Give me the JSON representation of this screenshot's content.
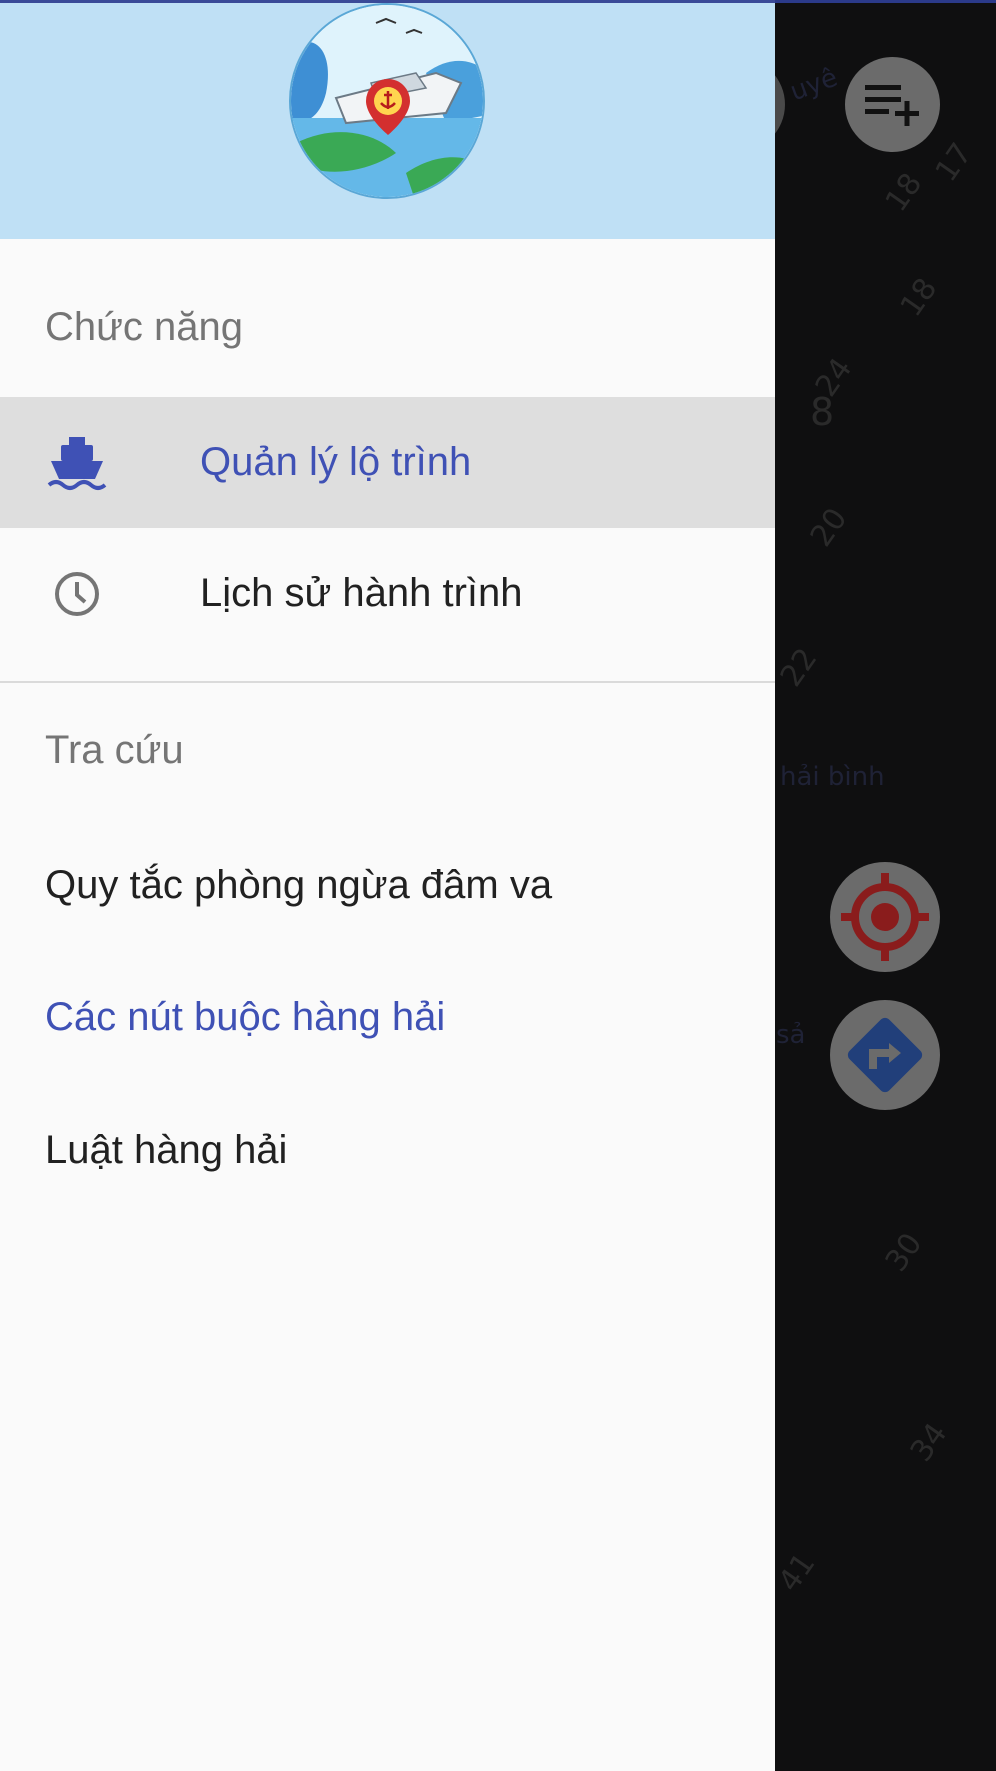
{
  "drawer": {
    "sections": [
      {
        "title": "Chức năng",
        "items": [
          {
            "label": "Quản lý lộ trình",
            "icon": "ship-icon",
            "active": true
          },
          {
            "label": "Lịch sử hành trình",
            "icon": "clock-icon",
            "active": false
          }
        ]
      },
      {
        "title": "Tra cứu",
        "items": [
          {
            "label": "Quy tắc phòng ngừa đâm va"
          },
          {
            "label": "Các nút buộc hàng hải"
          },
          {
            "label": "Luật hàng hải"
          }
        ]
      }
    ]
  },
  "map": {
    "depth_labels": [
      "17",
      "18",
      "18",
      "24",
      "8",
      "20",
      "22",
      "30",
      "34",
      "41"
    ],
    "place_labels": [
      "uyê",
      "hải bình",
      "sả"
    ]
  },
  "colors": {
    "accent": "#3f51b5",
    "header_bg": "#bfe0f5",
    "active_item_bg": "#dedede",
    "location_icon": "#c62828",
    "direction_icon": "#2f5fb3"
  }
}
